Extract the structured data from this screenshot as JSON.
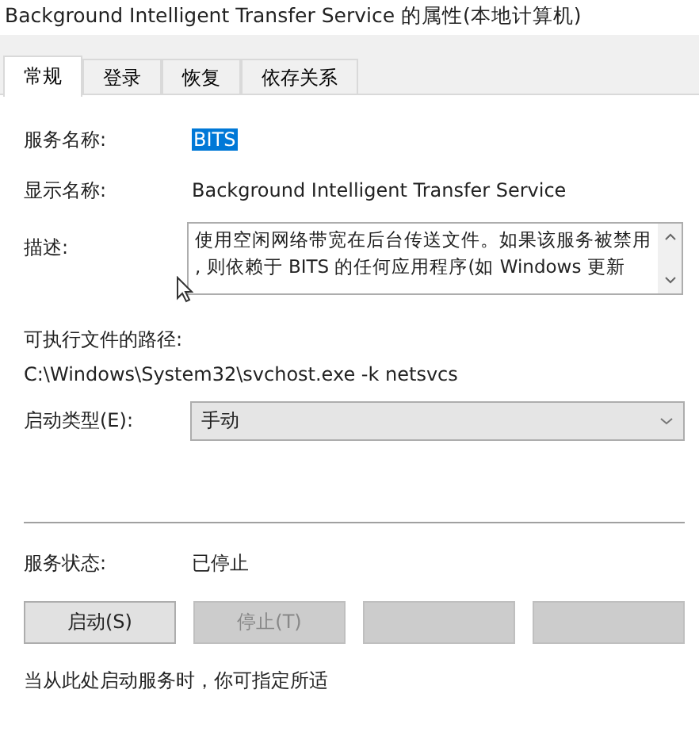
{
  "window": {
    "title": "Background Intelligent Transfer Service 的属性(本地计算机)"
  },
  "tabs": [
    {
      "label": "常规",
      "selected": true
    },
    {
      "label": "登录",
      "selected": false
    },
    {
      "label": "恢复",
      "selected": false
    },
    {
      "label": "依存关系",
      "selected": false
    }
  ],
  "service_name": {
    "label": "服务名称:",
    "value": "BITS",
    "selected": true
  },
  "display_name": {
    "label": "显示名称:",
    "value": "Background Intelligent Transfer Service"
  },
  "description": {
    "label": "描述:",
    "lines": [
      "使用空闲网络带宽在后台传送文件。如果该服务被禁用",
      ", 则依赖于 BITS 的任何应用程序(如 Windows 更新"
    ]
  },
  "executable_path": {
    "label": "可执行文件的路径:",
    "value": "C:\\Windows\\System32\\svchost.exe -k netsvcs"
  },
  "startup_type": {
    "label": "启动类型(E):",
    "value": "手动"
  },
  "service_status": {
    "label": "服务状态:",
    "value": "已停止"
  },
  "buttons": [
    {
      "label": "启动(S)",
      "disabled": false
    },
    {
      "label": "停止(T)",
      "disabled": true
    },
    {
      "disabled": true
    },
    {
      "disabled": true
    }
  ],
  "hint": "当从此处启动服务时，你可指定所适"
}
